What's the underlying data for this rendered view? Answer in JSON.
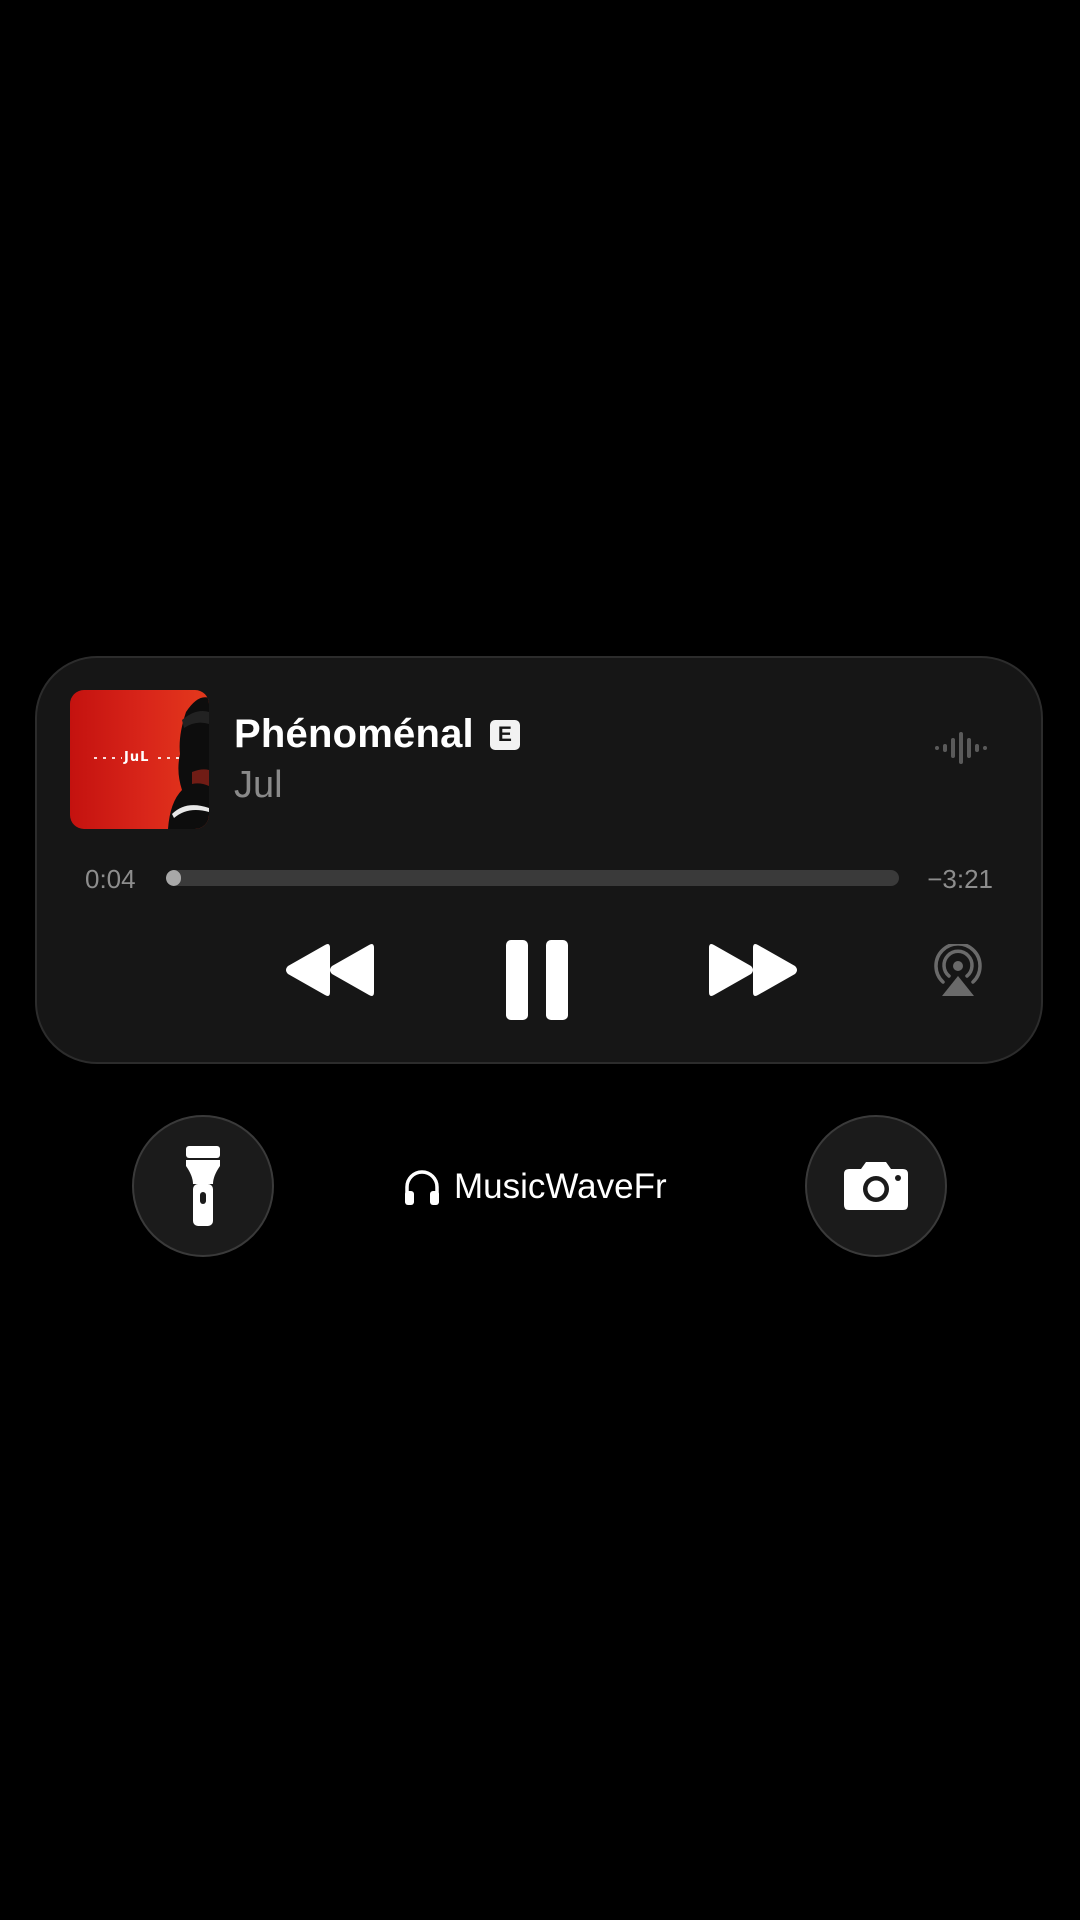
{
  "now_playing": {
    "title": "Phénoménal",
    "explicit_badge": "E",
    "artist": "Jul",
    "artwork_text": "JuL",
    "elapsed": "0:04",
    "remaining": "−3:21",
    "progress_fraction": 0.02,
    "controls": {
      "rewind": "backward-icon",
      "pause": "pause-icon",
      "forward": "forward-icon",
      "airplay": "airplay-icon"
    }
  },
  "lockscreen": {
    "left_button": "flashlight-icon",
    "right_button": "camera-icon",
    "audio_device_icon": "headphones-icon",
    "audio_device_name": "MusicWaveFr"
  },
  "colors": {
    "background": "#000000",
    "widget": "#161616",
    "artwork_red": "#d9261a",
    "secondary_text": "#8a8a8a"
  }
}
